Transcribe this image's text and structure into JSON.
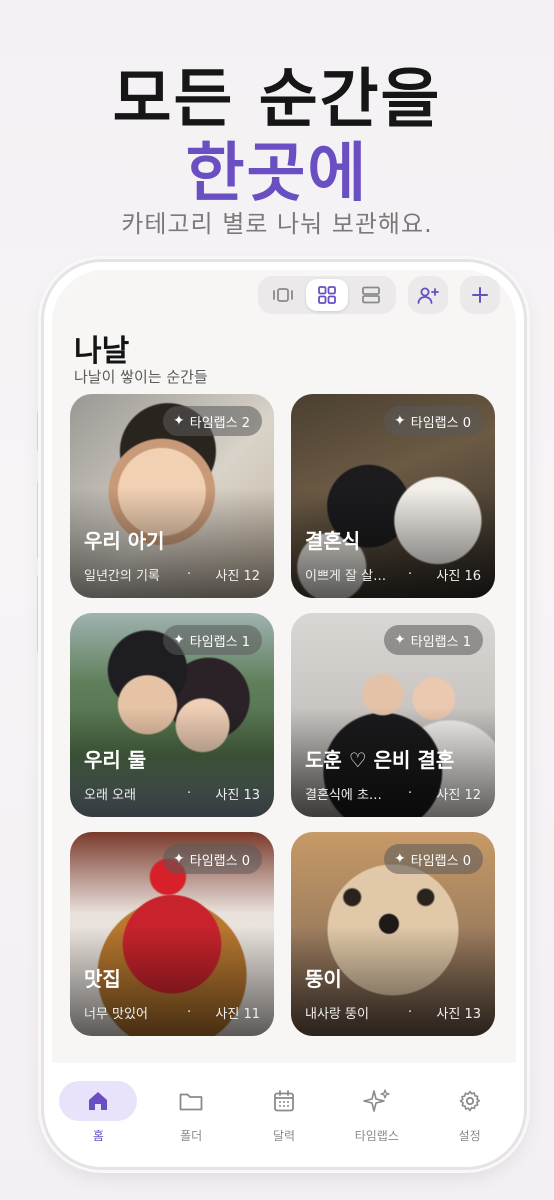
{
  "promo": {
    "headline_line1": "모든 순간을",
    "headline_line2": "한곳에",
    "subheadline": "카테고리 별로 나눠 보관해요."
  },
  "toolbar": {
    "view_modes": [
      "carousel-view-icon",
      "grid-view-icon",
      "list-view-icon"
    ],
    "active_view": "grid",
    "actions": [
      "add-member-icon",
      "plus-icon"
    ]
  },
  "album": {
    "title": "나날",
    "subtitle": "나날이 쌓이는 순간들"
  },
  "cards": [
    {
      "badge_label": "타임랩스 2",
      "title": "우리 아기",
      "desc": "일년간의 기록",
      "separator": "·",
      "count": "사진 12"
    },
    {
      "badge_label": "타임랩스 0",
      "title": "결혼식",
      "desc": "이쁘게 잘 살…",
      "separator": "·",
      "count": "사진 16"
    },
    {
      "badge_label": "타임랩스 1",
      "title": "우리 둘",
      "desc": "오래 오래",
      "separator": "·",
      "count": "사진 13"
    },
    {
      "badge_label": "타임랩스 1",
      "title": "도훈 ♡ 은비 결혼",
      "desc": "결혼식에 초…",
      "separator": "·",
      "count": "사진 12"
    },
    {
      "badge_label": "타임랩스 0",
      "title": "맛집",
      "desc": "너무 맛있어",
      "separator": "·",
      "count": "사진 11"
    },
    {
      "badge_label": "타임랩스 0",
      "title": "뚱이",
      "desc": "내사랑 뚱이",
      "separator": "·",
      "count": "사진 13"
    }
  ],
  "nav": [
    {
      "label": "홈",
      "icon": "home-icon",
      "active": true
    },
    {
      "label": "폴더",
      "icon": "folder-icon",
      "active": false
    },
    {
      "label": "달력",
      "icon": "calendar-icon",
      "active": false
    },
    {
      "label": "타임랩스",
      "icon": "sparkle-icon",
      "active": false
    },
    {
      "label": "설정",
      "icon": "gear-icon",
      "active": false
    }
  ],
  "colors": {
    "accent": "#6a4fc2",
    "accent_soft": "#e8e3fb",
    "headline": "#161616"
  }
}
